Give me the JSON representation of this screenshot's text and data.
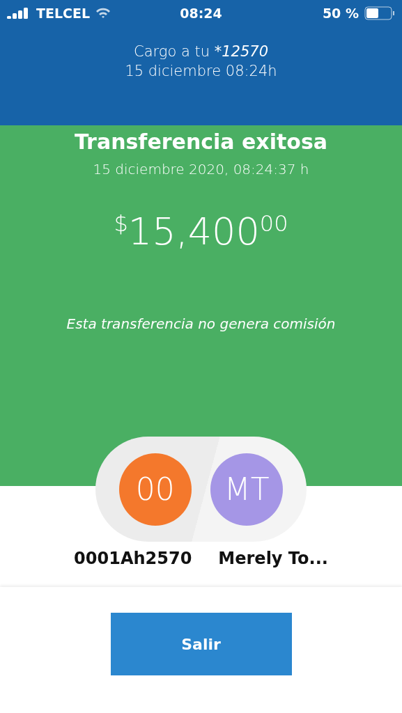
{
  "status_bar": {
    "carrier": "TELCEL",
    "time": "08:24",
    "battery_text": "50 %"
  },
  "header": {
    "prefix": "Cargo a tu",
    "account": "*12570",
    "date": "15 diciembre 08:24h"
  },
  "result": {
    "title": "Transferencia exitosa",
    "datetime": "15 diciembre 2020, 08:24:37 h",
    "currency": "$",
    "amount": "15,400",
    "cents": "00",
    "note": "Esta transferencia no genera comisión"
  },
  "parties": [
    {
      "initials": "00",
      "name": "0001Ah2570",
      "color": "#f4782c"
    },
    {
      "initials": "MT",
      "name": "Merely To...",
      "color": "#a596e6"
    }
  ],
  "button": {
    "label": "Salir"
  }
}
